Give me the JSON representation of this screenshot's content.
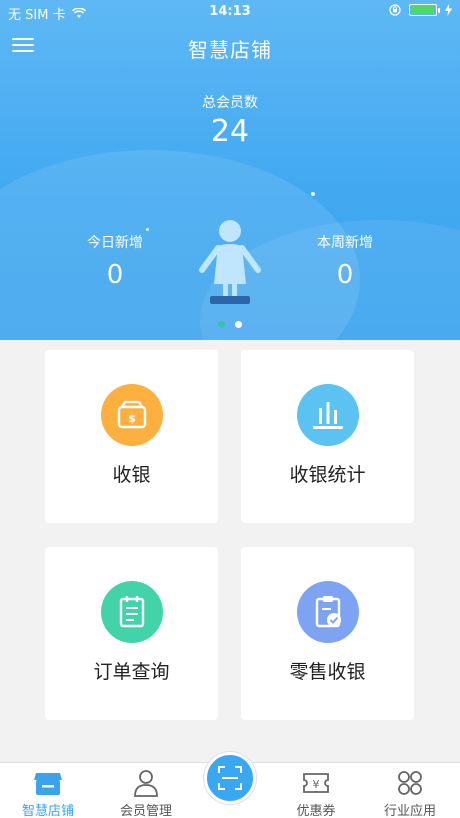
{
  "status": {
    "carrier": "无 SIM 卡",
    "time": "14:13"
  },
  "nav": {
    "title": "智慧店铺"
  },
  "summary": {
    "total_label": "总会员数",
    "total_value": "24",
    "today_label": "今日新增",
    "today_value": "0",
    "week_label": "本周新增",
    "week_value": "0"
  },
  "pager": {
    "count": 2,
    "active": 2
  },
  "cards": [
    {
      "label": "收银",
      "icon": "cash-box-icon",
      "color": "#fbb040"
    },
    {
      "label": "收银统计",
      "icon": "bar-chart-icon",
      "color": "#5cc2f2"
    },
    {
      "label": "订单查询",
      "icon": "order-list-icon",
      "color": "#43d3a9"
    },
    {
      "label": "零售收银",
      "icon": "clipboard-check-icon",
      "color": "#7ea3f2"
    }
  ],
  "tabs": [
    {
      "label": "智慧店铺",
      "icon": "store-icon",
      "active": true
    },
    {
      "label": "会员管理",
      "icon": "member-icon",
      "active": false
    },
    {
      "label": "优惠券",
      "icon": "coupon-icon",
      "active": false
    },
    {
      "label": "行业应用",
      "icon": "apps-icon",
      "active": false
    }
  ],
  "colors": {
    "accent": "#3aa3ee",
    "header": "#42a9f1"
  }
}
